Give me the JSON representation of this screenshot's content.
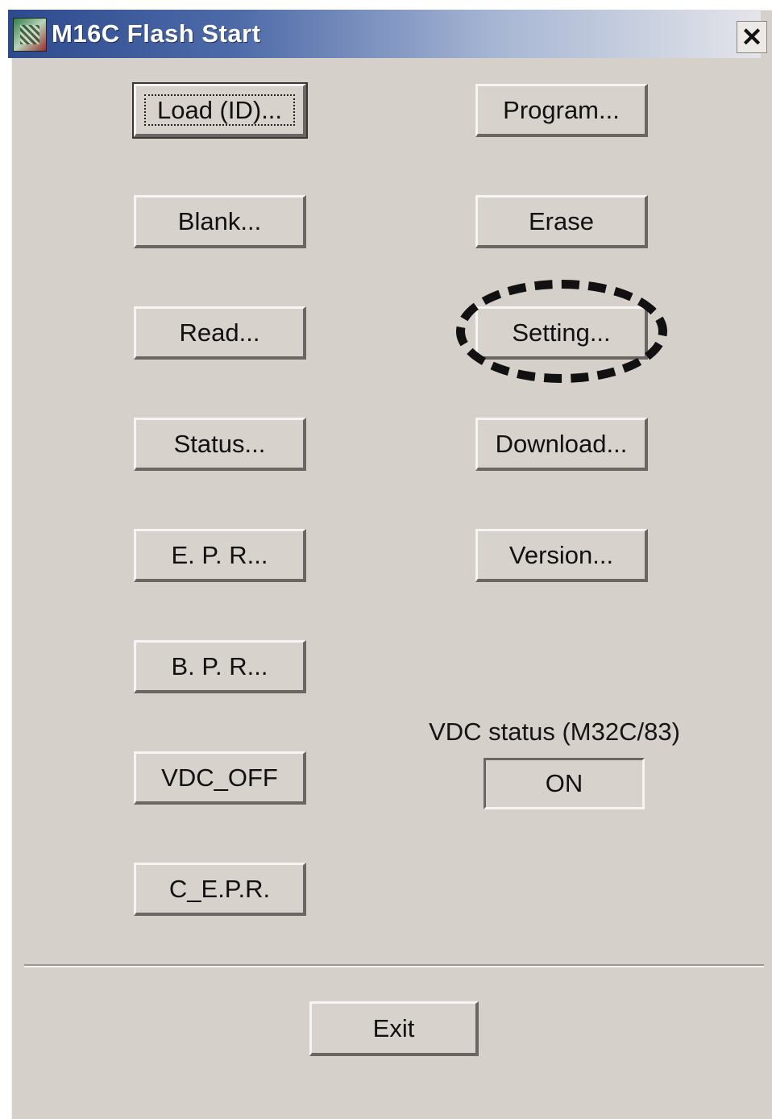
{
  "window": {
    "title": "M16C Flash Start",
    "close_label": "✕"
  },
  "buttons": {
    "load": "Load (ID)...",
    "program": "Program...",
    "blank": "Blank...",
    "erase": "Erase",
    "read": "Read...",
    "setting": "Setting...",
    "status": "Status...",
    "download": "Download...",
    "epr": "E. P. R...",
    "version": "Version...",
    "bpr": "B. P. R...",
    "vdc_off": "VDC_OFF",
    "cepr": "C_E.P.R.",
    "exit": "Exit"
  },
  "vdc": {
    "label": "VDC status (M32C/83)",
    "value": "ON"
  },
  "icons": {
    "app": "app-logo-icon",
    "close": "close-icon"
  }
}
